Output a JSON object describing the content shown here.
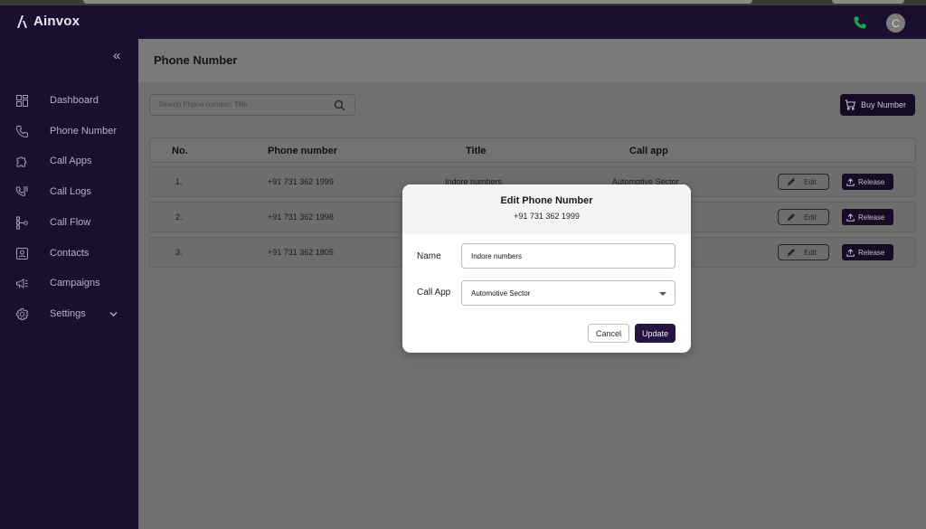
{
  "app": {
    "name": "Ainvox",
    "avatar_initial": "C",
    "accent_color": "#24143f",
    "call_icon_color": "#1fa34a"
  },
  "sidebar": {
    "collapse_icon": "chevrons-left-icon",
    "items": [
      {
        "label": "Dashboard",
        "icon": "grid-icon"
      },
      {
        "label": "Phone Number",
        "icon": "phone-icon"
      },
      {
        "label": "Call Apps",
        "icon": "puzzle-icon"
      },
      {
        "label": "Call Logs",
        "icon": "phone-list-icon"
      },
      {
        "label": "Call Flow",
        "icon": "flow-icon"
      },
      {
        "label": "Contacts",
        "icon": "contact-card-icon"
      },
      {
        "label": "Campaigns",
        "icon": "megaphone-icon"
      },
      {
        "label": "Settings",
        "icon": "gear-icon"
      }
    ]
  },
  "page": {
    "title": "Phone Number",
    "search_placeholder": "Search Phone number, Title",
    "buy_button": "Buy Number"
  },
  "table": {
    "columns": [
      "No.",
      "Phone number",
      "Title",
      "Call app"
    ],
    "rows": [
      {
        "no": "1.",
        "phone": "+91 731 362 1999",
        "title": "Indore numbers",
        "call_app": "Automotive Sector"
      },
      {
        "no": "2.",
        "phone": "+91 731 362 1998",
        "title": "",
        "call_app": ""
      },
      {
        "no": "3.",
        "phone": "+91 731 362 1805",
        "title": "",
        "call_app": ""
      }
    ],
    "edit_label": "Edit",
    "release_label": "Release"
  },
  "modal": {
    "title": "Edit Phone Number",
    "subtitle": "+91 731 362 1999",
    "name_label": "Name",
    "name_value": "Indore numbers",
    "call_app_label": "Call App",
    "call_app_value": "Automotive Sector",
    "cancel_label": "Cancel",
    "update_label": "Update"
  }
}
